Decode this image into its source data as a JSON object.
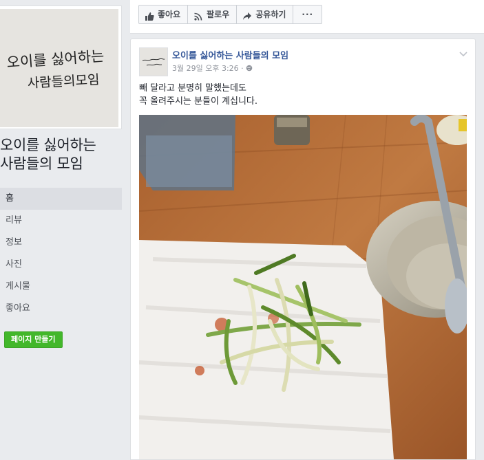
{
  "page": {
    "name": "오이를 싫어하는 사람들의 모임",
    "name_line1": "오이를 싫어하는",
    "name_line2": "사람들의 모임",
    "profile_text_line1": "오이를 싫어하는",
    "profile_text_line2": "사람들의모임"
  },
  "sidebar": {
    "items": [
      {
        "label": "홈",
        "active": true
      },
      {
        "label": "리뷰"
      },
      {
        "label": "정보"
      },
      {
        "label": "사진"
      },
      {
        "label": "게시물"
      },
      {
        "label": "좋아요"
      }
    ],
    "create_page_label": "페이지 만들기"
  },
  "action_bar": {
    "like_label": "좋아요",
    "follow_label": "팔로우",
    "share_label": "공유하기",
    "more_label": "···"
  },
  "post": {
    "author": "오이를 싫어하는 사람들의 모임",
    "timestamp": "3월 29일 오후 3:26 ·",
    "text_line1": "빼 달라고 분명히 말했는데도",
    "text_line2": "꼭 올려주시는 분들이 계십니다.",
    "icons": {
      "privacy": "globe-icon",
      "menu": "chevron-down-icon"
    }
  },
  "colors": {
    "accent": "#365899",
    "button_green": "#42b72a",
    "background": "#e9ebee"
  }
}
